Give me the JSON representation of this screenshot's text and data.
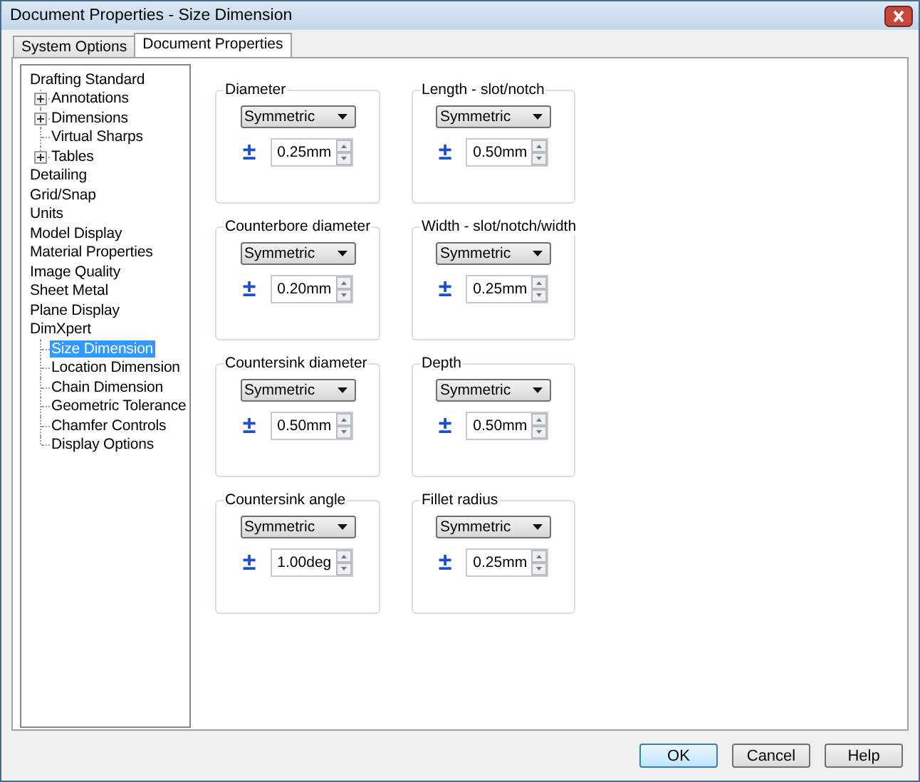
{
  "window": {
    "title": "Document Properties - Size Dimension"
  },
  "tabs": [
    {
      "label": "System Options",
      "selected": false
    },
    {
      "label": "Document Properties",
      "selected": true
    }
  ],
  "tree": [
    {
      "label": "Drafting Standard",
      "selected": false,
      "children": [
        {
          "label": "Annotations",
          "kind": "collapsed",
          "selected": false
        },
        {
          "label": "Dimensions",
          "kind": "collapsed",
          "selected": false
        },
        {
          "label": "Virtual Sharps",
          "kind": "leaf",
          "selected": false
        },
        {
          "label": "Tables",
          "kind": "collapsed",
          "selected": false
        }
      ]
    },
    {
      "label": "Detailing",
      "selected": false
    },
    {
      "label": "Grid/Snap",
      "selected": false
    },
    {
      "label": "Units",
      "selected": false
    },
    {
      "label": "Model Display",
      "selected": false
    },
    {
      "label": "Material Properties",
      "selected": false
    },
    {
      "label": "Image Quality",
      "selected": false
    },
    {
      "label": "Sheet Metal",
      "selected": false
    },
    {
      "label": "Plane Display",
      "selected": false
    },
    {
      "label": "DimXpert",
      "selected": false,
      "children": [
        {
          "label": "Size Dimension",
          "kind": "leaf",
          "selected": true
        },
        {
          "label": "Location Dimension",
          "kind": "leaf",
          "selected": false
        },
        {
          "label": "Chain Dimension",
          "kind": "leaf",
          "selected": false
        },
        {
          "label": "Geometric Tolerance",
          "kind": "leaf",
          "selected": false
        },
        {
          "label": "Chamfer Controls",
          "kind": "leaf",
          "selected": false
        },
        {
          "label": "Display Options",
          "kind": "leaf",
          "selected": false
        }
      ]
    }
  ],
  "groups": [
    {
      "title": "Diameter",
      "type": "Symmetric",
      "sign": "±",
      "value": "0.25mm"
    },
    {
      "title": "Length - slot/notch",
      "type": "Symmetric",
      "sign": "±",
      "value": "0.50mm"
    },
    {
      "title": "Counterbore diameter",
      "type": "Symmetric",
      "sign": "±",
      "value": "0.20mm"
    },
    {
      "title": "Width - slot/notch/width",
      "type": "Symmetric",
      "sign": "±",
      "value": "0.25mm"
    },
    {
      "title": "Countersink diameter",
      "type": "Symmetric",
      "sign": "±",
      "value": "0.50mm"
    },
    {
      "title": "Depth",
      "type": "Symmetric",
      "sign": "±",
      "value": "0.50mm"
    },
    {
      "title": "Countersink angle",
      "type": "Symmetric",
      "sign": "±",
      "value": "1.00deg"
    },
    {
      "title": "Fillet radius",
      "type": "Symmetric",
      "sign": "±",
      "value": "0.25mm"
    }
  ],
  "buttons": [
    "OK",
    "Cancel",
    "Help"
  ]
}
